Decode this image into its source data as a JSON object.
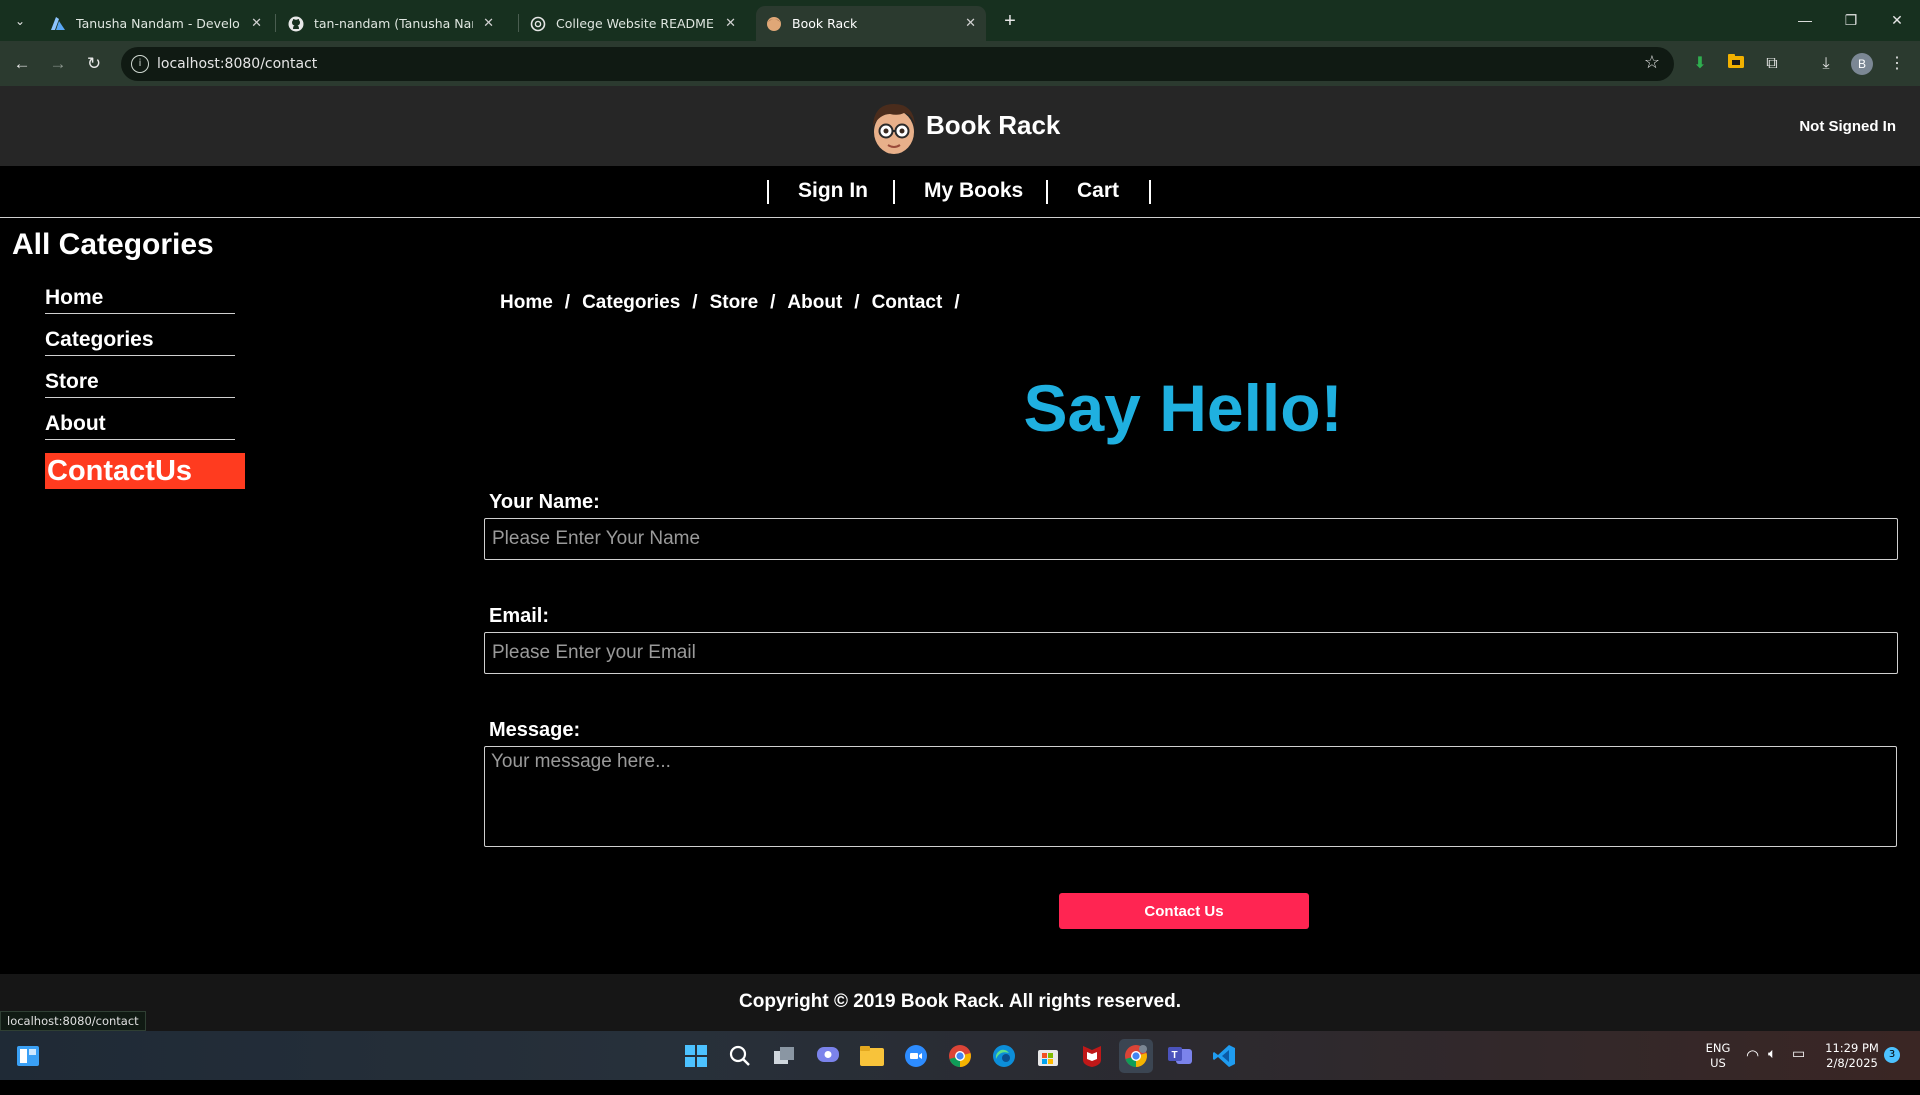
{
  "browser": {
    "tabs": [
      {
        "title": "Tanusha Nandam - Developer P",
        "icon": "azure-icon"
      },
      {
        "title": "tan-nandam (Tanusha Nandam)",
        "icon": "github-icon"
      },
      {
        "title": "College Website README Guide",
        "icon": "openai-icon"
      },
      {
        "title": "Book Rack",
        "icon": "bookrack-favicon",
        "active": true
      }
    ],
    "url": "localhost:8080/contact",
    "profile_initial": "B",
    "status_url": "localhost:8080/contact"
  },
  "site": {
    "brand": "Book Rack",
    "signin_state": "Not Signed In",
    "nav": [
      "Sign In",
      "My Books",
      "Cart"
    ]
  },
  "sidebar": {
    "title": "All Categories",
    "items": [
      "Home",
      "Categories",
      "Store",
      "About"
    ],
    "active": "ContactUs"
  },
  "breadcrumb": [
    "Home",
    "Categories",
    "Store",
    "About",
    "Contact"
  ],
  "breadcrumb_sep": "/",
  "contact": {
    "heading": "Say Hello!",
    "name_label": "Your Name:",
    "name_placeholder": "Please Enter Your Name",
    "email_label": "Email:",
    "email_placeholder": "Please Enter your Email",
    "message_label": "Message:",
    "message_placeholder": "Your message here...",
    "submit_label": "Contact Us"
  },
  "footer": {
    "copyright": "Copyright © 2019 Book Rack. All rights reserved."
  },
  "taskbar": {
    "lang": "ENG",
    "region": "US",
    "time": "11:29 PM",
    "date": "2/8/2025",
    "notifications": "3",
    "apps": [
      "start-icon",
      "search-icon",
      "task-view-icon",
      "chat-icon",
      "file-explorer-icon",
      "zoom-icon",
      "chrome-icon",
      "edge-icon",
      "store-icon",
      "mcafee-icon",
      "chrome-profile-icon",
      "teams-icon",
      "vscode-icon"
    ]
  },
  "colors": {
    "accent_heading": "#1fb0e0",
    "active_sidebar": "#ff3b1f",
    "submit_button": "#ff2552",
    "header_bg": "#262626"
  }
}
